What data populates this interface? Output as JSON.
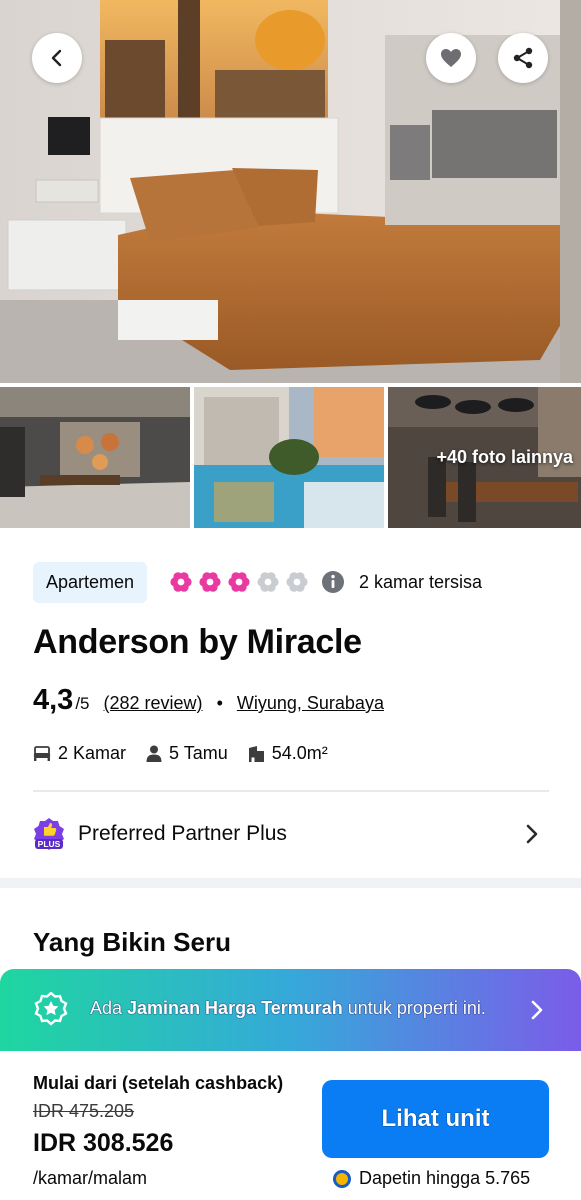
{
  "photos": {
    "more_label": "+40 foto lainnya"
  },
  "property": {
    "type": "Apartemen",
    "star_rating": 3,
    "star_max": 5,
    "rooms_left": "2 kamar tersisa",
    "name": "Anderson by Miracle",
    "rating": "4,3",
    "rating_max": "/5",
    "reviews": "(282 review)",
    "bullet": "•",
    "location": "Wiyung, Surabaya",
    "facts": {
      "rooms": "2 Kamar",
      "guests": "5 Tamu",
      "size": "54.0m²"
    },
    "partner": "Preferred Partner Plus"
  },
  "section": {
    "title": "Yang Bikin Seru"
  },
  "promo": {
    "prefix": "Ada ",
    "highlight": "Jaminan Harga Termurah",
    "suffix": " untuk properti ini."
  },
  "pricing": {
    "label": "Mulai dari (setelah cashback)",
    "original": "IDR 475.205",
    "current": "IDR 308.526",
    "unit": "/kamar/malam",
    "cta": "Lihat unit",
    "cashback": "Dapetin hingga 5.765"
  },
  "colors": {
    "star_filled": "#e83aa0",
    "star_empty": "#c9ccd1",
    "primary": "#0a7df5",
    "chip_bg": "#e7f3fd"
  },
  "icons": {
    "back": "chevron-left-icon",
    "favorite": "heart-icon",
    "share": "share-icon",
    "info": "info-icon",
    "bed": "bed-icon",
    "guest": "person-icon",
    "size": "building-icon",
    "partner": "partner-plus-badge-icon",
    "promo": "award-icon",
    "coin": "coin-icon"
  }
}
